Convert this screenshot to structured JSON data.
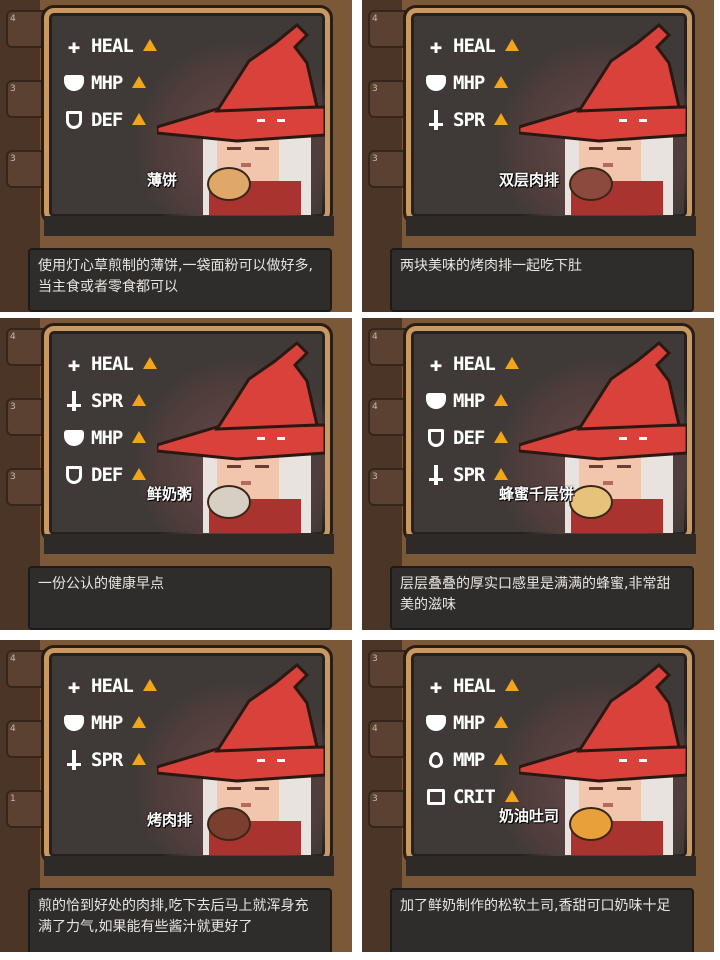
{
  "colors": {
    "panel_bg": "#7b5838",
    "card_bg": "#3f3a37",
    "card_border": "#c89a62",
    "hat_red": "#d9423a",
    "stat_arrow": "#f3a51a",
    "text_white": "#ffffff"
  },
  "panels": [
    {
      "food_name": "薄饼",
      "food_icon": "pancake",
      "food_color": "#e0a868",
      "stats": [
        {
          "icon": "cross-icon",
          "label": "HEAL"
        },
        {
          "icon": "heart-icon",
          "label": "MHP"
        },
        {
          "icon": "shield-icon",
          "label": "DEF"
        }
      ],
      "row_numbers": [
        "4",
        "3",
        "3"
      ],
      "description": "使用灯心草煎制的薄饼,一袋面粉可以做好多,当主食或者零食都可以"
    },
    {
      "food_name": "双层肉排",
      "food_icon": "double-steak",
      "food_color": "#8c4a3f",
      "stats": [
        {
          "icon": "cross-icon",
          "label": "HEAL"
        },
        {
          "icon": "heart-icon",
          "label": "MHP"
        },
        {
          "icon": "sword-icon",
          "label": "SPR"
        }
      ],
      "row_numbers": [
        "4",
        "3",
        "3"
      ],
      "description": "两块美味的烤肉排一起吃下肚"
    },
    {
      "food_name": "鲜奶粥",
      "food_icon": "milk-porridge",
      "food_color": "#d8cfc4",
      "stats": [
        {
          "icon": "cross-icon",
          "label": "HEAL"
        },
        {
          "icon": "sword-icon",
          "label": "SPR"
        },
        {
          "icon": "heart-icon",
          "label": "MHP"
        },
        {
          "icon": "shield-icon",
          "label": "DEF"
        }
      ],
      "row_numbers": [
        "4",
        "3",
        "3"
      ],
      "description": "一份公认的健康早点"
    },
    {
      "food_name": "蜂蜜千层饼",
      "food_icon": "honey-crepe-cake",
      "food_color": "#e6c27a",
      "stats": [
        {
          "icon": "cross-icon",
          "label": "HEAL"
        },
        {
          "icon": "heart-icon",
          "label": "MHP"
        },
        {
          "icon": "shield-icon",
          "label": "DEF"
        },
        {
          "icon": "sword-icon",
          "label": "SPR"
        }
      ],
      "row_numbers": [
        "4",
        "4",
        "3"
      ],
      "description": "层层叠叠的厚实口感里是满满的蜂蜜,非常甜美的滋味"
    },
    {
      "food_name": "烤肉排",
      "food_icon": "grilled-steak",
      "food_color": "#7a3f2f",
      "stats": [
        {
          "icon": "cross-icon",
          "label": "HEAL"
        },
        {
          "icon": "heart-icon",
          "label": "MHP"
        },
        {
          "icon": "sword-icon",
          "label": "SPR"
        }
      ],
      "row_numbers": [
        "4",
        "4",
        "1"
      ],
      "description": "煎的恰到好处的肉排,吃下去后马上就浑身充满了力气,如果能有些酱汁就更好了"
    },
    {
      "food_name": "奶油吐司",
      "food_icon": "butter-toast",
      "food_color": "#e8a13a",
      "stats": [
        {
          "icon": "cross-icon",
          "label": "HEAL"
        },
        {
          "icon": "heart-icon",
          "label": "MHP"
        },
        {
          "icon": "drop-icon",
          "label": "MMP"
        },
        {
          "icon": "crit-icon",
          "label": "CRIT"
        }
      ],
      "row_numbers": [
        "3",
        "4",
        "3"
      ],
      "description": "加了鲜奶制作的松软土司,香甜可口奶味十足"
    }
  ]
}
